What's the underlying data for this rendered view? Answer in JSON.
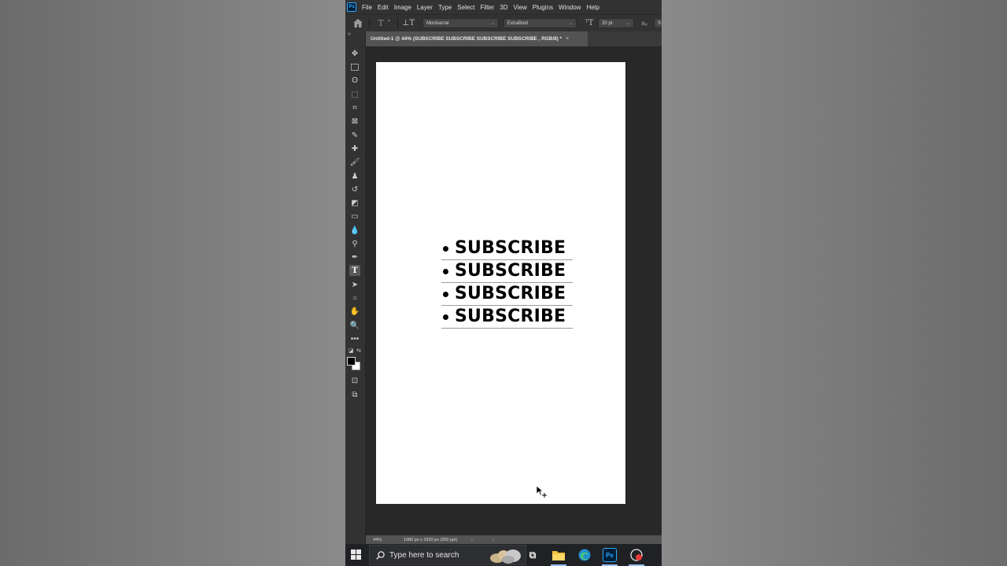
{
  "app": {
    "logo_text": "Ps",
    "menu": [
      "File",
      "Edit",
      "Image",
      "Layer",
      "Type",
      "Select",
      "Filter",
      "3D",
      "View",
      "Plugins",
      "Window",
      "Help"
    ]
  },
  "options": {
    "font_family": "Montserrat",
    "font_style": "ExtraBold",
    "font_size": "20 pt"
  },
  "document": {
    "tab_title": "Untitled-1 @ 44% (SUBSCRIBE SUBSCRIBE SUBSCRIBE SUBSCRIBE , RGB/8) *",
    "tab_close": "×",
    "lines": [
      "SUBSCRIBE",
      "SUBSCRIBE",
      "SUBSCRIBE",
      "SUBSCRIBE"
    ]
  },
  "status": {
    "zoom": "44%",
    "dimensions": "1080 px x 1920 px (300 ppi)",
    "arrow": ">",
    "scroll": "<"
  },
  "taskbar": {
    "search_placeholder": "Type here to search",
    "ps_label": "Ps"
  },
  "colors": {
    "foreground": "#000000",
    "background": "#ffffff",
    "ps_accent": "#31a8ff"
  }
}
